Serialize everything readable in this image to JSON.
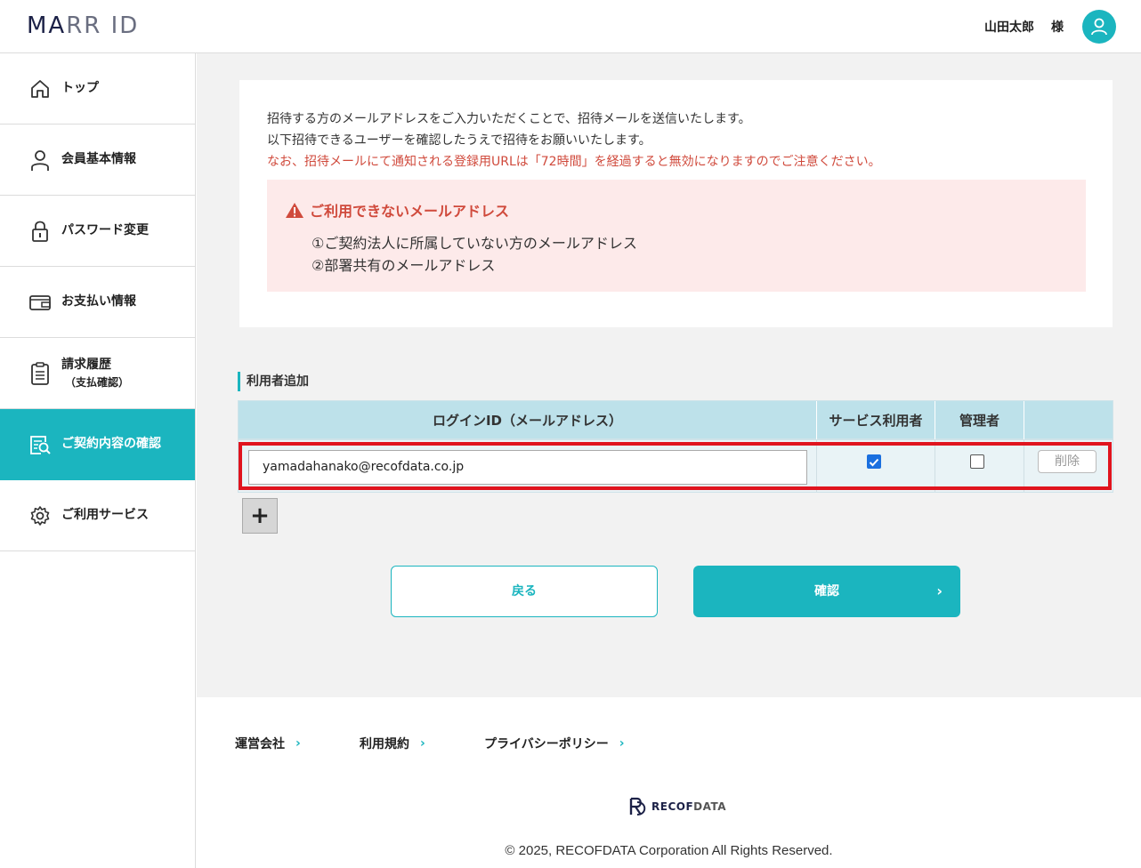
{
  "header": {
    "logo_part1": "MA",
    "logo_part2": "RR ID",
    "user_name": "山田太郎",
    "user_suffix": "様"
  },
  "sidebar": {
    "items": [
      {
        "label": "トップ",
        "icon": "home-icon"
      },
      {
        "label": "会員基本情報",
        "icon": "person-icon"
      },
      {
        "label": "パスワード変更",
        "icon": "lock-icon"
      },
      {
        "label": "お支払い情報",
        "icon": "wallet-icon"
      },
      {
        "label": "請求履歴",
        "sub": "（支払確認）",
        "icon": "clipboard-icon"
      },
      {
        "label": "ご契約内容の確認",
        "icon": "contract-search-icon",
        "active": true
      },
      {
        "label": "ご利用サービス",
        "icon": "gear-icon"
      }
    ]
  },
  "notice": {
    "line1": "招待する方のメールアドレスをご入力いただくことで、招待メールを送信いたします。",
    "line2": "以下招待できるユーザーを確認したうえで招待をお願いいたします。",
    "line3": "なお、招待メールにて通知される登録用URLは「72時間」を経過すると無効になりますのでご注意ください。",
    "warning_title": "ご利用できないメールアドレス",
    "warning_item1": "①ご契約法人に所属していない方のメールアドレス",
    "warning_item2": "②部署共有のメールアドレス"
  },
  "user_add": {
    "section_title": "利用者追加",
    "columns": [
      "ログインID（メールアドレス）",
      "サービス利用者",
      "管理者",
      ""
    ],
    "rows": [
      {
        "email": "yamadahanako@recofdata.co.jp",
        "service_user": true,
        "admin": false,
        "delete_label": "削除"
      }
    ],
    "add_label": "+"
  },
  "actions": {
    "back_label": "戻る",
    "confirm_label": "確認",
    "confirm_chevron": "›"
  },
  "footer": {
    "links": [
      "運営会社",
      "利用規約",
      "プライバシーポリシー"
    ],
    "link_arrow": "›",
    "brand_part1": "RECOF",
    "brand_part2": "DATA",
    "copyright": "© 2025, RECOFDATA Corporation All Rights Reserved."
  },
  "colors": {
    "accent": "#1bb5bf",
    "warning_text": "#d04a3c",
    "warning_bg": "#fdeaea",
    "highlight": "#e0141e"
  }
}
